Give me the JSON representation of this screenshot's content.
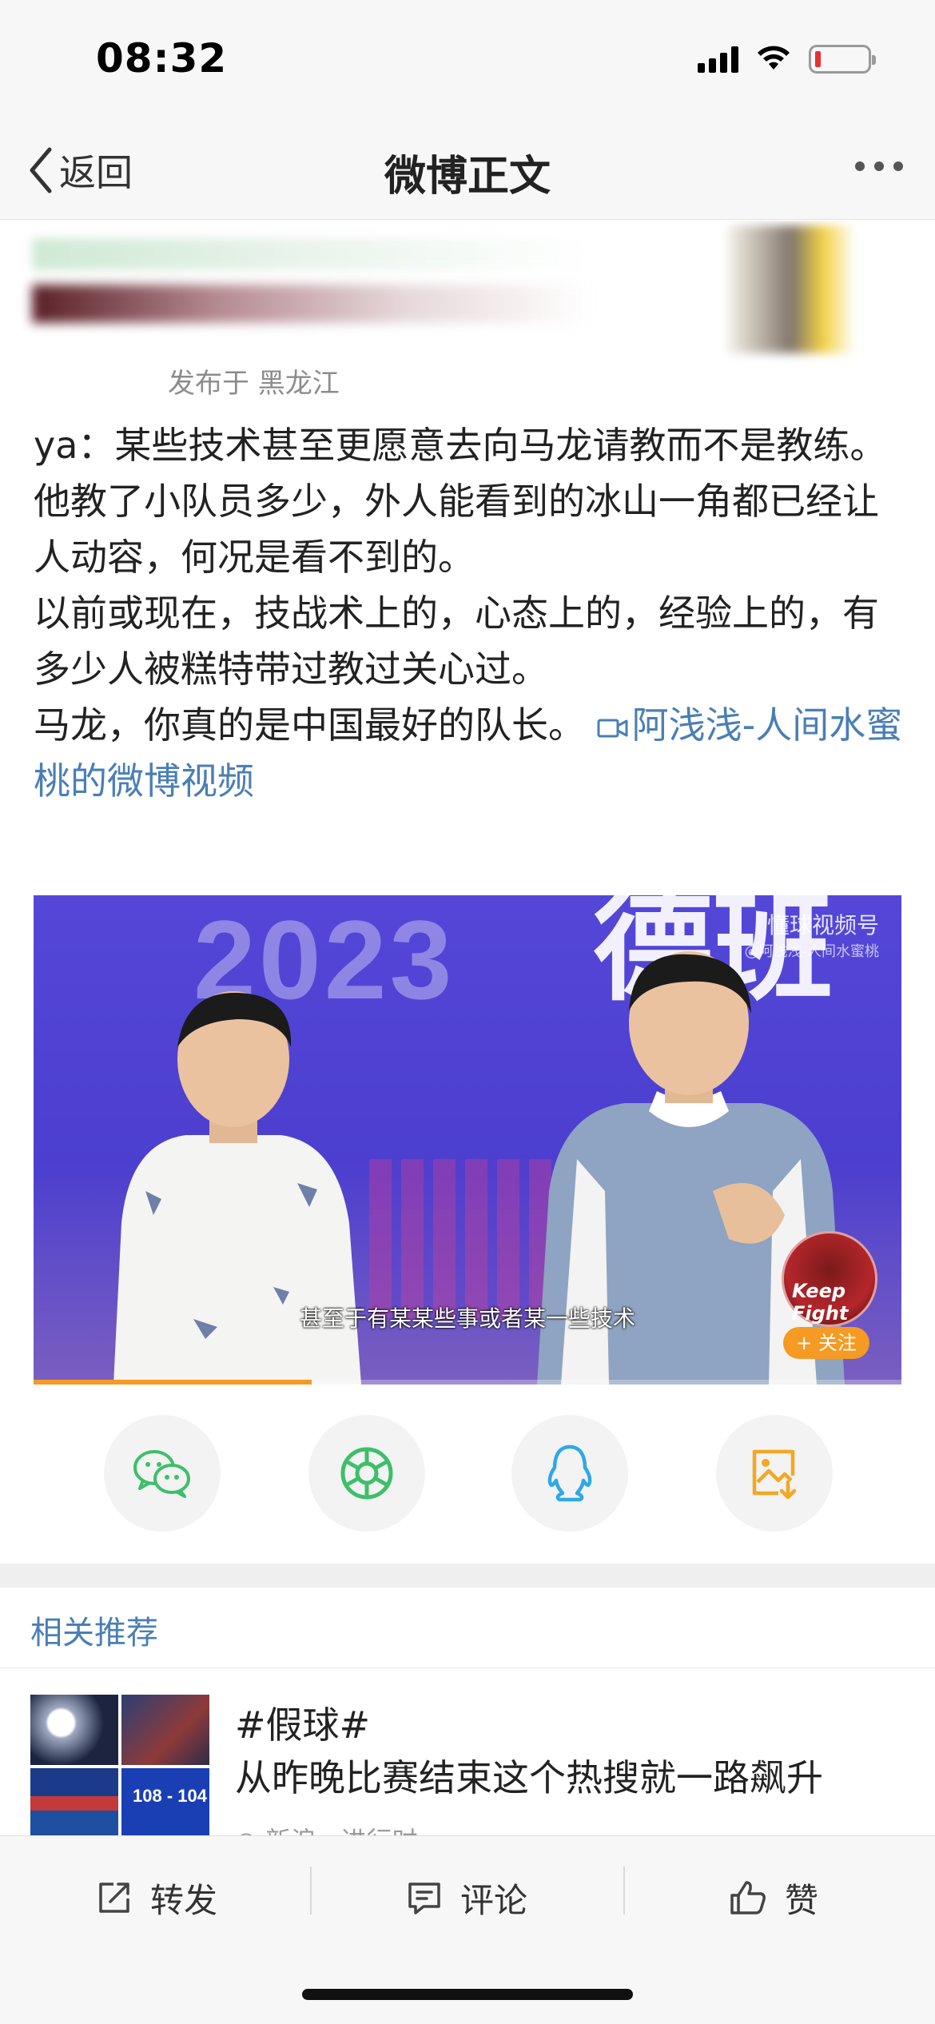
{
  "status_bar": {
    "time": "08:32"
  },
  "nav": {
    "back_label": "返回",
    "title": "微博正文"
  },
  "author": {
    "location": "发布于 黑龙江"
  },
  "post": {
    "paragraphs": [
      "ya：某些技术甚至更愿意去向马龙请教而不是教练。",
      "他教了小队员多少，外人能看到的冰山一角都已经让人动容，何况是看不到的。",
      "以前或现在，技战术上的，心态上的，经验上的，有多少人被糕特带过教过关心过。"
    ],
    "last_paragraph": "马龙，你真的是中国最好的队长。",
    "video_link": "阿浅浅-人间水蜜桃的微博视频"
  },
  "video": {
    "year_text": "2023",
    "big_text": "德班",
    "watermark_top": "懂球视频号",
    "watermark_bottom": "@阿浅浅-人间水蜜桃",
    "subtitle": "甚至于有某某些事或者某一些技术",
    "avatar_text": "Keep Fight",
    "follow_label": "+ 关注",
    "progress": 0.32
  },
  "share": {
    "items": [
      {
        "icon": "wechat-icon",
        "color": "#3dbf6a"
      },
      {
        "icon": "moments-icon",
        "color": "#3dbf6a"
      },
      {
        "icon": "qq-icon",
        "color": "#2fa8e8"
      },
      {
        "icon": "save-image-icon",
        "color": "#f5a623"
      }
    ]
  },
  "related": {
    "header": "相关推荐",
    "item": {
      "title": "#假球#",
      "desc": "从昨晚比赛结束这个热搜就一路飙升",
      "meta": "◎ 新浪 · 进行时",
      "thumb_score": "108 - 104"
    }
  },
  "actions": {
    "repost": "转发",
    "comment": "评论",
    "like": "赞"
  }
}
